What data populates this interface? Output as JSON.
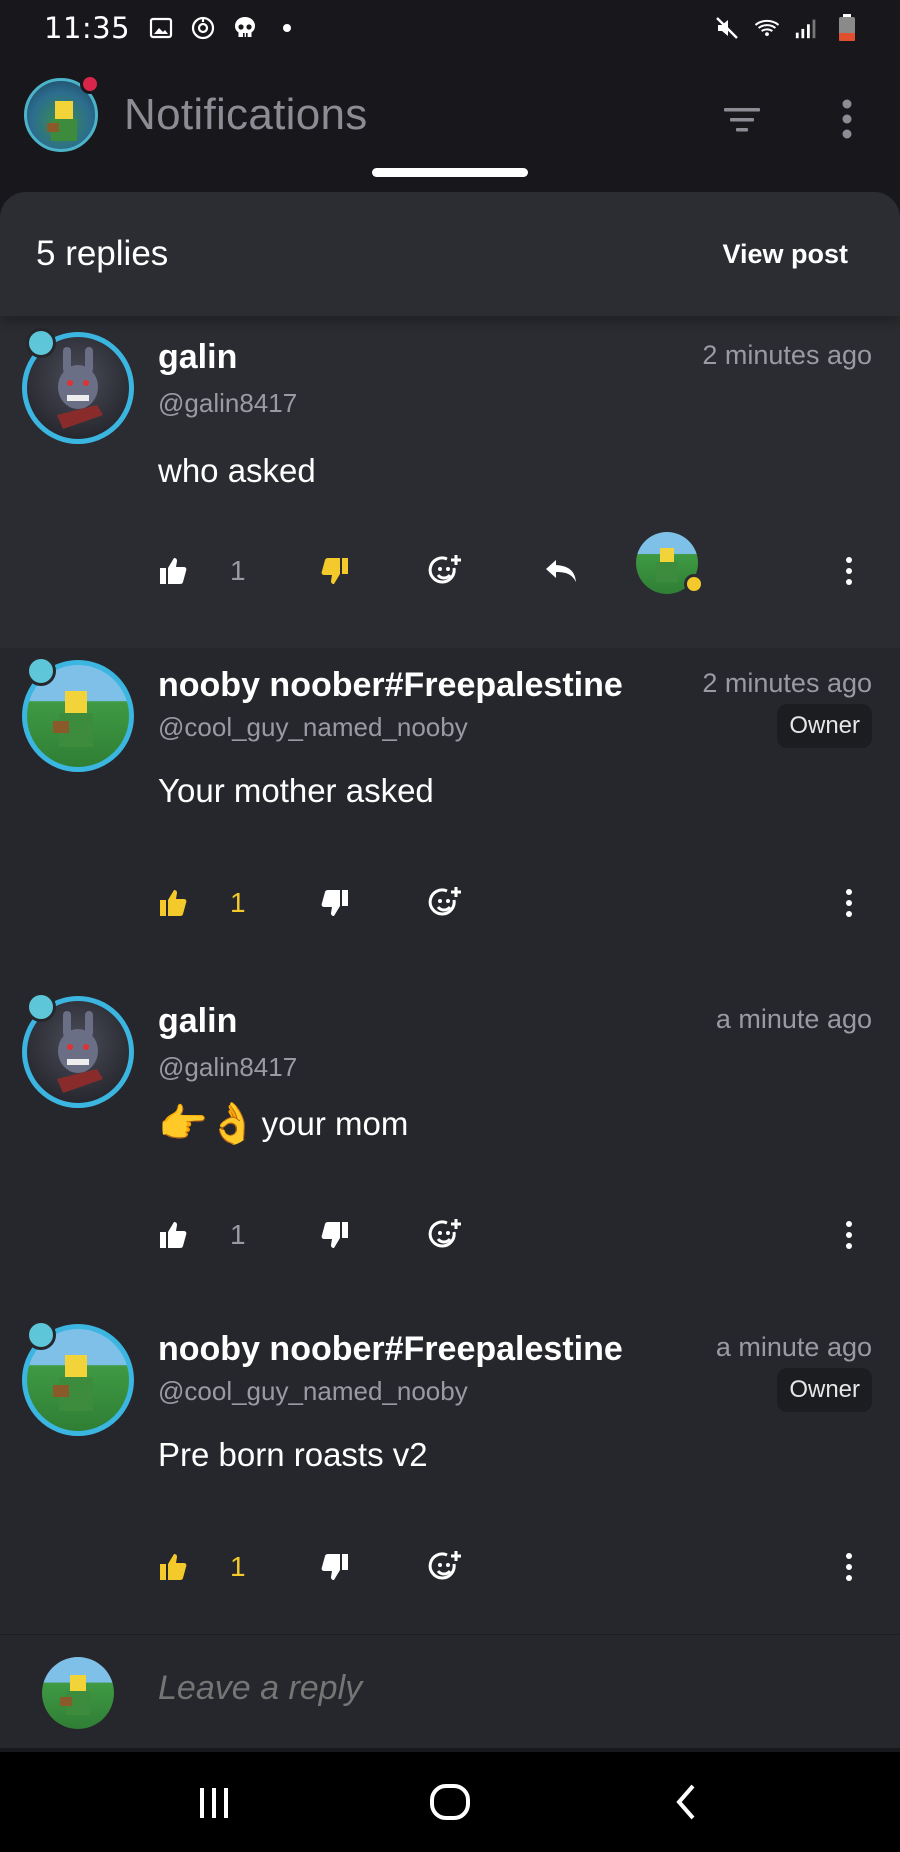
{
  "status_bar": {
    "time": "11:35",
    "left_icons": [
      "image-icon",
      "sync-icon",
      "skull-icon",
      "dot-icon"
    ],
    "right_icons": [
      "mute-icon",
      "wifi-icon",
      "signal-icon",
      "battery-icon"
    ]
  },
  "header": {
    "title": "Notifications",
    "icons": [
      "filter-icon",
      "more-vert-icon"
    ],
    "badge_color": "#d7264a"
  },
  "sheet": {
    "title": "5 replies",
    "view_post": "View post"
  },
  "replies": [
    {
      "username": "galin",
      "handle": "@galin8417",
      "time": "2 minutes ago",
      "text": "who asked",
      "likes": "1",
      "liked": false,
      "disliked": true,
      "highlighted": true,
      "has_reply_button": true
    },
    {
      "username": "nooby noober#Freepalestine",
      "handle": "@cool_guy_named_nooby",
      "time": "2 minutes ago",
      "role": "Owner",
      "text": "Your mother asked",
      "likes": "1",
      "liked": true,
      "disliked": false
    },
    {
      "username": "galin",
      "handle": "@galin8417",
      "time": "a minute ago",
      "emoji": "👉👌",
      "text": "your mom",
      "likes": "1",
      "liked": false,
      "disliked": false
    },
    {
      "username": "nooby noober#Freepalestine",
      "handle": "@cool_guy_named_nooby",
      "time": "a minute ago",
      "role": "Owner",
      "text": "Pre born roasts v2",
      "likes": "1",
      "liked": true,
      "disliked": false
    }
  ],
  "composer": {
    "placeholder": "Leave a reply"
  },
  "nav": {
    "icons": [
      "recent-apps-icon",
      "home-icon",
      "back-icon"
    ]
  },
  "colors": {
    "accent_yellow": "#f3c92c",
    "avatar_ring": "#3bb6e0",
    "sheet_bg": "#26272c",
    "highlight_bg": "#2b2c31"
  }
}
